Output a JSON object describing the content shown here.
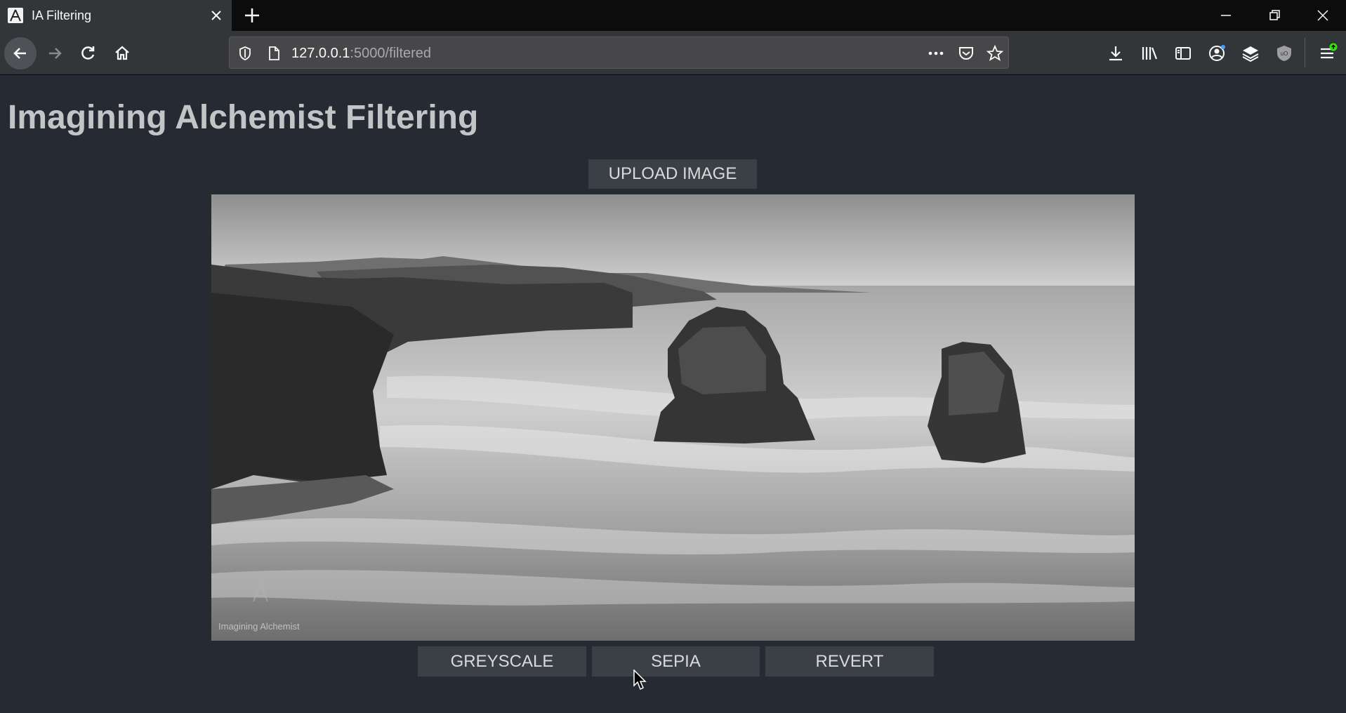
{
  "browser": {
    "tab_title": "IA Filtering",
    "url_host": "127.0.0.1",
    "url_rest": ":5000/filtered"
  },
  "page": {
    "title": "Imagining Alchemist Filtering",
    "upload_label": "UPLOAD IMAGE",
    "image_watermark": "Imagining Alchemist",
    "filters": {
      "greyscale_label": "GREYSCALE",
      "sepia_label": "SEPIA",
      "revert_label": "REVERT"
    }
  },
  "colors": {
    "page_bg": "#252a33",
    "button_bg": "#3b3f46",
    "button_text": "#dadada",
    "title_text": "#c3c4c6"
  }
}
